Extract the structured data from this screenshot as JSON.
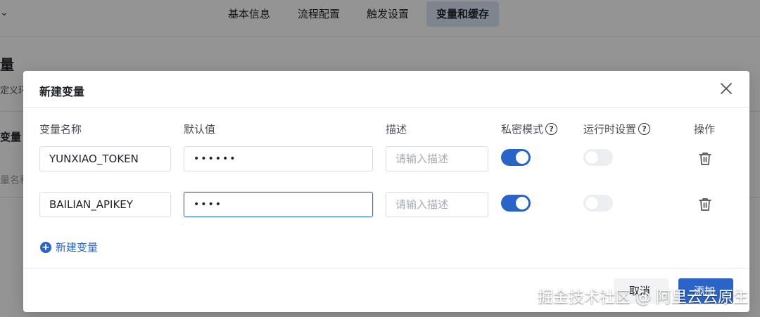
{
  "nav": {
    "tabs": [
      "基本信息",
      "流程配置",
      "触发设置",
      "变量和缓存"
    ],
    "active_index": 3
  },
  "background": {
    "title": "量",
    "subtitle": "定义环",
    "section": "变量",
    "placeholder": "量名称"
  },
  "modal": {
    "title": "新建变量",
    "columns": {
      "name": "变量名称",
      "default": "默认值",
      "desc": "描述",
      "secret": "私密模式",
      "runtime": "运行时设置",
      "actions": "操作"
    },
    "rows": [
      {
        "name": "YUNXIAO_TOKEN",
        "default_masked": "••••••",
        "desc_placeholder": "请输入描述",
        "secret": true,
        "runtime": false
      },
      {
        "name": "BAILIAN_APIKEY",
        "default_masked": "••••",
        "desc_placeholder": "请输入描述",
        "secret": true,
        "runtime": false
      }
    ],
    "add_label": "新建变量",
    "cancel_label": "取消",
    "add_button_label": "添加"
  },
  "watermark": "掘金技术社区 @ 阿里云云原生",
  "colors": {
    "primary": "#2b64c8",
    "switch_off": "#eceef1",
    "active_tab": "#dbe6f7"
  }
}
